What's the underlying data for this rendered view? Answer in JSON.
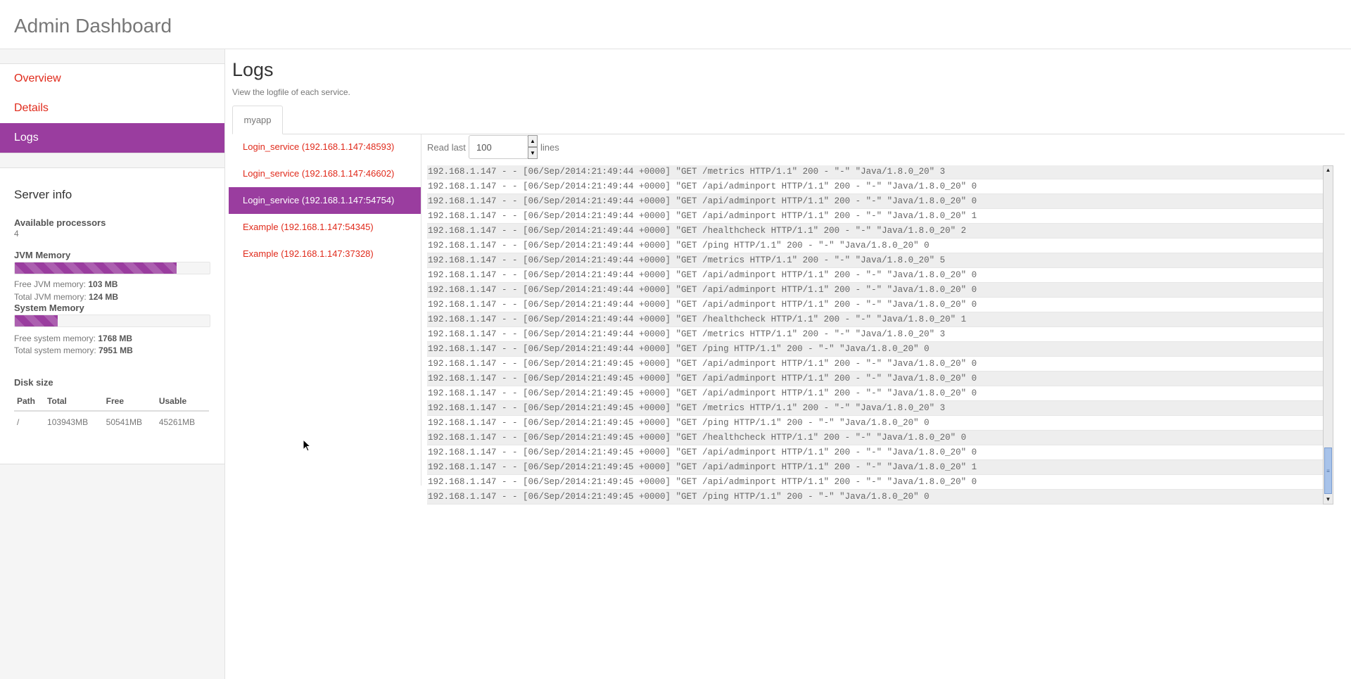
{
  "header": {
    "title": "Admin Dashboard"
  },
  "nav": {
    "items": [
      {
        "label": "Overview",
        "active": false
      },
      {
        "label": "Details",
        "active": false
      },
      {
        "label": "Logs",
        "active": true
      }
    ]
  },
  "server_info": {
    "heading": "Server info",
    "available_processors_label": "Available processors",
    "available_processors": "4",
    "jvm_memory_label": "JVM Memory",
    "jvm_used_fraction": 0.83,
    "free_jvm_label": "Free JVM memory:",
    "free_jvm_value": "103 MB",
    "total_jvm_label": "Total JVM memory:",
    "total_jvm_value": "124 MB",
    "system_memory_label": "System Memory",
    "system_used_fraction": 0.22,
    "free_system_label": "Free system memory:",
    "free_system_value": "1768 MB",
    "total_system_label": "Total system memory:",
    "total_system_value": "7951 MB",
    "disk_size_label": "Disk size",
    "disk_columns": [
      "Path",
      "Total",
      "Free",
      "Usable"
    ],
    "disk_rows": [
      [
        "/",
        "103943MB",
        "50541MB",
        "45261MB"
      ]
    ]
  },
  "main": {
    "title": "Logs",
    "subtitle": "View the logfile of each service.",
    "tab": "myapp",
    "services": [
      {
        "label": "Login_service (192.168.1.147:48593)",
        "active": false
      },
      {
        "label": "Login_service (192.168.1.147:46602)",
        "active": false
      },
      {
        "label": "Login_service (192.168.1.147:54754)",
        "active": true
      },
      {
        "label": "Example (192.168.1.147:54345)",
        "active": false
      },
      {
        "label": "Example (192.168.1.147:37328)",
        "active": false
      }
    ],
    "read_last_label": "Read last",
    "read_last_value": "100",
    "lines_label": "lines",
    "log_lines": [
      "192.168.1.147 - - [06/Sep/2014:21:49:44 +0000] \"GET /metrics HTTP/1.1\" 200 - \"-\" \"Java/1.8.0_20\" 3",
      "192.168.1.147 - - [06/Sep/2014:21:49:44 +0000] \"GET /api/adminport HTTP/1.1\" 200 - \"-\" \"Java/1.8.0_20\" 0",
      "192.168.1.147 - - [06/Sep/2014:21:49:44 +0000] \"GET /api/adminport HTTP/1.1\" 200 - \"-\" \"Java/1.8.0_20\" 0",
      "192.168.1.147 - - [06/Sep/2014:21:49:44 +0000] \"GET /api/adminport HTTP/1.1\" 200 - \"-\" \"Java/1.8.0_20\" 1",
      "192.168.1.147 - - [06/Sep/2014:21:49:44 +0000] \"GET /healthcheck HTTP/1.1\" 200 - \"-\" \"Java/1.8.0_20\" 2",
      "192.168.1.147 - - [06/Sep/2014:21:49:44 +0000] \"GET /ping HTTP/1.1\" 200 - \"-\" \"Java/1.8.0_20\" 0",
      "192.168.1.147 - - [06/Sep/2014:21:49:44 +0000] \"GET /metrics HTTP/1.1\" 200 - \"-\" \"Java/1.8.0_20\" 5",
      "192.168.1.147 - - [06/Sep/2014:21:49:44 +0000] \"GET /api/adminport HTTP/1.1\" 200 - \"-\" \"Java/1.8.0_20\" 0",
      "192.168.1.147 - - [06/Sep/2014:21:49:44 +0000] \"GET /api/adminport HTTP/1.1\" 200 - \"-\" \"Java/1.8.0_20\" 0",
      "192.168.1.147 - - [06/Sep/2014:21:49:44 +0000] \"GET /api/adminport HTTP/1.1\" 200 - \"-\" \"Java/1.8.0_20\" 0",
      "192.168.1.147 - - [06/Sep/2014:21:49:44 +0000] \"GET /healthcheck HTTP/1.1\" 200 - \"-\" \"Java/1.8.0_20\" 1",
      "192.168.1.147 - - [06/Sep/2014:21:49:44 +0000] \"GET /metrics HTTP/1.1\" 200 - \"-\" \"Java/1.8.0_20\" 3",
      "192.168.1.147 - - [06/Sep/2014:21:49:44 +0000] \"GET /ping HTTP/1.1\" 200 - \"-\" \"Java/1.8.0_20\" 0",
      "192.168.1.147 - - [06/Sep/2014:21:49:45 +0000] \"GET /api/adminport HTTP/1.1\" 200 - \"-\" \"Java/1.8.0_20\" 0",
      "192.168.1.147 - - [06/Sep/2014:21:49:45 +0000] \"GET /api/adminport HTTP/1.1\" 200 - \"-\" \"Java/1.8.0_20\" 0",
      "192.168.1.147 - - [06/Sep/2014:21:49:45 +0000] \"GET /api/adminport HTTP/1.1\" 200 - \"-\" \"Java/1.8.0_20\" 0",
      "192.168.1.147 - - [06/Sep/2014:21:49:45 +0000] \"GET /metrics HTTP/1.1\" 200 - \"-\" \"Java/1.8.0_20\" 3",
      "192.168.1.147 - - [06/Sep/2014:21:49:45 +0000] \"GET /ping HTTP/1.1\" 200 - \"-\" \"Java/1.8.0_20\" 0",
      "192.168.1.147 - - [06/Sep/2014:21:49:45 +0000] \"GET /healthcheck HTTP/1.1\" 200 - \"-\" \"Java/1.8.0_20\" 0",
      "192.168.1.147 - - [06/Sep/2014:21:49:45 +0000] \"GET /api/adminport HTTP/1.1\" 200 - \"-\" \"Java/1.8.0_20\" 0",
      "192.168.1.147 - - [06/Sep/2014:21:49:45 +0000] \"GET /api/adminport HTTP/1.1\" 200 - \"-\" \"Java/1.8.0_20\" 1",
      "192.168.1.147 - - [06/Sep/2014:21:49:45 +0000] \"GET /api/adminport HTTP/1.1\" 200 - \"-\" \"Java/1.8.0_20\" 0",
      "192.168.1.147 - - [06/Sep/2014:21:49:45 +0000] \"GET /ping HTTP/1.1\" 200 - \"-\" \"Java/1.8.0_20\" 0"
    ]
  },
  "colors": {
    "accent": "#9a3d9f",
    "link": "#e02a1b",
    "scroll_thumb": "#a8c3ea"
  },
  "icons": {
    "spinner_up": "chevron-up-icon",
    "spinner_down": "chevron-down-icon",
    "cursor": "mouse-pointer-icon"
  }
}
